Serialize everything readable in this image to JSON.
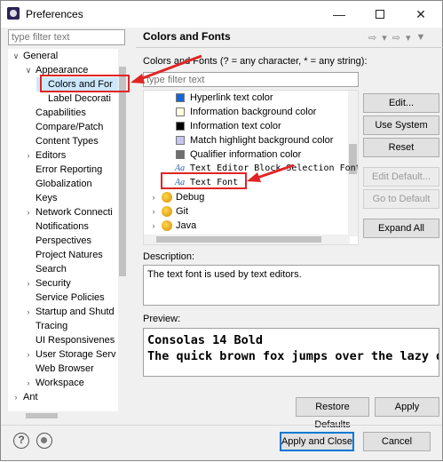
{
  "window": {
    "title": "Preferences"
  },
  "left": {
    "filter_placeholder": "type filter text",
    "tree": [
      {
        "label": "General",
        "arrow": "v",
        "indent": 0
      },
      {
        "label": "Appearance",
        "arrow": "v",
        "indent": 1
      },
      {
        "label": "Colors and For",
        "arrow": "",
        "indent": 2,
        "selected": true
      },
      {
        "label": "Label Decorati",
        "arrow": "",
        "indent": 2
      },
      {
        "label": "Capabilities",
        "arrow": "",
        "indent": 1
      },
      {
        "label": "Compare/Patch",
        "arrow": "",
        "indent": 1
      },
      {
        "label": "Content Types",
        "arrow": "",
        "indent": 1
      },
      {
        "label": "Editors",
        "arrow": ">",
        "indent": 1
      },
      {
        "label": "Error Reporting",
        "arrow": "",
        "indent": 1
      },
      {
        "label": "Globalization",
        "arrow": "",
        "indent": 1
      },
      {
        "label": "Keys",
        "arrow": "",
        "indent": 1
      },
      {
        "label": "Network Connecti",
        "arrow": ">",
        "indent": 1
      },
      {
        "label": "Notifications",
        "arrow": "",
        "indent": 1
      },
      {
        "label": "Perspectives",
        "arrow": "",
        "indent": 1
      },
      {
        "label": "Project Natures",
        "arrow": "",
        "indent": 1
      },
      {
        "label": "Search",
        "arrow": "",
        "indent": 1
      },
      {
        "label": "Security",
        "arrow": ">",
        "indent": 1
      },
      {
        "label": "Service Policies",
        "arrow": "",
        "indent": 1
      },
      {
        "label": "Startup and Shutd",
        "arrow": ">",
        "indent": 1
      },
      {
        "label": "Tracing",
        "arrow": "",
        "indent": 1
      },
      {
        "label": "UI Responsivenes",
        "arrow": "",
        "indent": 1
      },
      {
        "label": "User Storage Serv",
        "arrow": ">",
        "indent": 1
      },
      {
        "label": "Web Browser",
        "arrow": "",
        "indent": 1
      },
      {
        "label": "Workspace",
        "arrow": ">",
        "indent": 1
      },
      {
        "label": "Ant",
        "arrow": ">",
        "indent": 0
      }
    ]
  },
  "right": {
    "title": "Colors and Fonts",
    "pattern_label": "Colors and Fonts (? = any character, * = any string):",
    "filter_placeholder": "type filter text",
    "items": [
      {
        "label": "Hyperlink text color",
        "kind": "swatch",
        "color": "#1565d8"
      },
      {
        "label": "Information background color",
        "kind": "swatch",
        "color": "#ffffe1"
      },
      {
        "label": "Information text color",
        "kind": "swatch",
        "color": "#000000"
      },
      {
        "label": "Match highlight background color",
        "kind": "swatch",
        "color": "#c5c6f0"
      },
      {
        "label": "Qualifier information color",
        "kind": "swatch",
        "color": "#6e6e6e"
      },
      {
        "label": "Text Editor Block Selection Font",
        "kind": "font"
      },
      {
        "label": "Text Font",
        "kind": "font",
        "selected": true
      },
      {
        "label": "Debug",
        "kind": "category"
      },
      {
        "label": "Git",
        "kind": "category"
      },
      {
        "label": "Java",
        "kind": "category"
      }
    ],
    "buttons": {
      "edit": "Edit...",
      "use_system_font": "Use System Font",
      "reset": "Reset",
      "edit_default": "Edit Default...",
      "go_to_default": "Go to Default",
      "expand_all": "Expand All"
    },
    "description_label": "Description:",
    "description_text": "The text font is used by text editors.",
    "preview_label": "Preview:",
    "preview_line1": "Consolas 14 Bold",
    "preview_line2": "The quick brown fox jumps over the lazy d",
    "restore_defaults": "Restore Defaults",
    "apply": "Apply"
  },
  "footer": {
    "apply_and_close": "Apply and Close",
    "cancel": "Cancel"
  },
  "colors": {
    "highlight_red": "#e02424",
    "selection_blue": "#cce8ff"
  }
}
